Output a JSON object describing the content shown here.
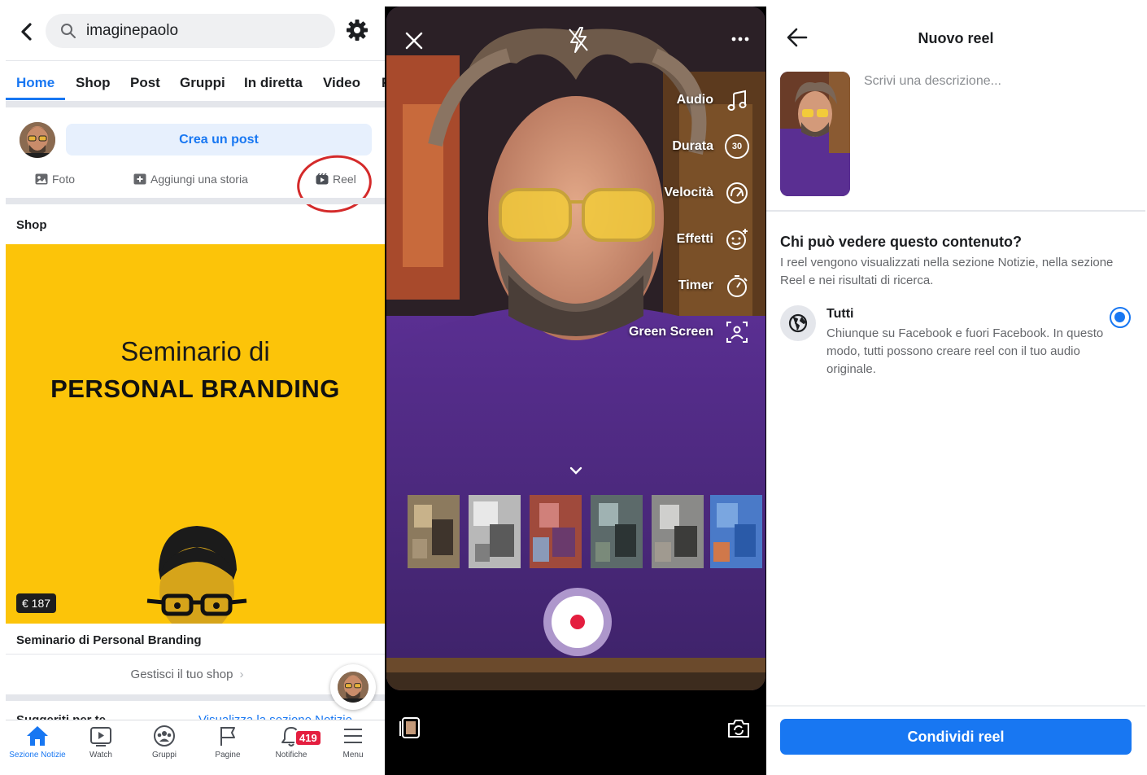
{
  "panel_profile": {
    "search": {
      "value": "imaginepaolo"
    },
    "tabs": [
      {
        "label": "Home"
      },
      {
        "label": "Shop"
      },
      {
        "label": "Post"
      },
      {
        "label": "Gruppi"
      },
      {
        "label": "In diretta"
      },
      {
        "label": "Video"
      }
    ],
    "create_post_label": "Crea un post",
    "actions": {
      "photo": "Foto",
      "story": "Aggiungi una storia",
      "reel": "Reel"
    },
    "shop_heading": "Shop",
    "banner": {
      "line1": "Seminario di",
      "line2": "PERSONAL BRANDING"
    },
    "price": "€ 187",
    "product_title": "Seminario di Personal Branding",
    "manage_shop": "Gestisci il tuo shop",
    "suggested": "Suggeriti per te",
    "view_section": "Visualizza la sezione Notizie",
    "bottom_nav": [
      {
        "label": "Sezione Notizie",
        "icon": "home-icon"
      },
      {
        "label": "Watch",
        "icon": "watch-icon"
      },
      {
        "label": "Gruppi",
        "icon": "groups-icon"
      },
      {
        "label": "Pagine",
        "icon": "pages-flag-icon"
      },
      {
        "label": "Notifiche",
        "icon": "bell-icon"
      },
      {
        "label": "Menu",
        "icon": "menu-icon"
      }
    ],
    "notification_count": "419",
    "colors": {
      "accent": "#1877f2",
      "banner": "#fcc409",
      "badge": "#e41e3f",
      "annotation": "#d42a2a"
    }
  },
  "panel_camera": {
    "tools": [
      {
        "label": "Audio",
        "icon": "music-note-icon"
      },
      {
        "label": "Durata",
        "icon": "timer-30-icon"
      },
      {
        "label": "Velocità",
        "icon": "speed-gauge-icon"
      },
      {
        "label": "Effetti",
        "icon": "effects-smiley-icon"
      },
      {
        "label": "Timer",
        "icon": "stopwatch-icon"
      },
      {
        "label": "Green Screen",
        "icon": "green-screen-icon"
      }
    ],
    "duration_badge": "30"
  },
  "panel_new_reel": {
    "title": "Nuovo reel",
    "description_placeholder": "Scrivi una descrizione...",
    "audience_question": "Chi può vedere questo contenuto?",
    "audience_info": "I reel vengono visualizzati nella sezione Notizie, nella sezione Reel e nei risultati di ricerca.",
    "option_title": "Tutti",
    "option_desc": "Chiunque su Facebook e fuori Facebook. In questo modo, tutti possono creare reel con il tuo audio originale.",
    "share_button": "Condividi reel"
  }
}
